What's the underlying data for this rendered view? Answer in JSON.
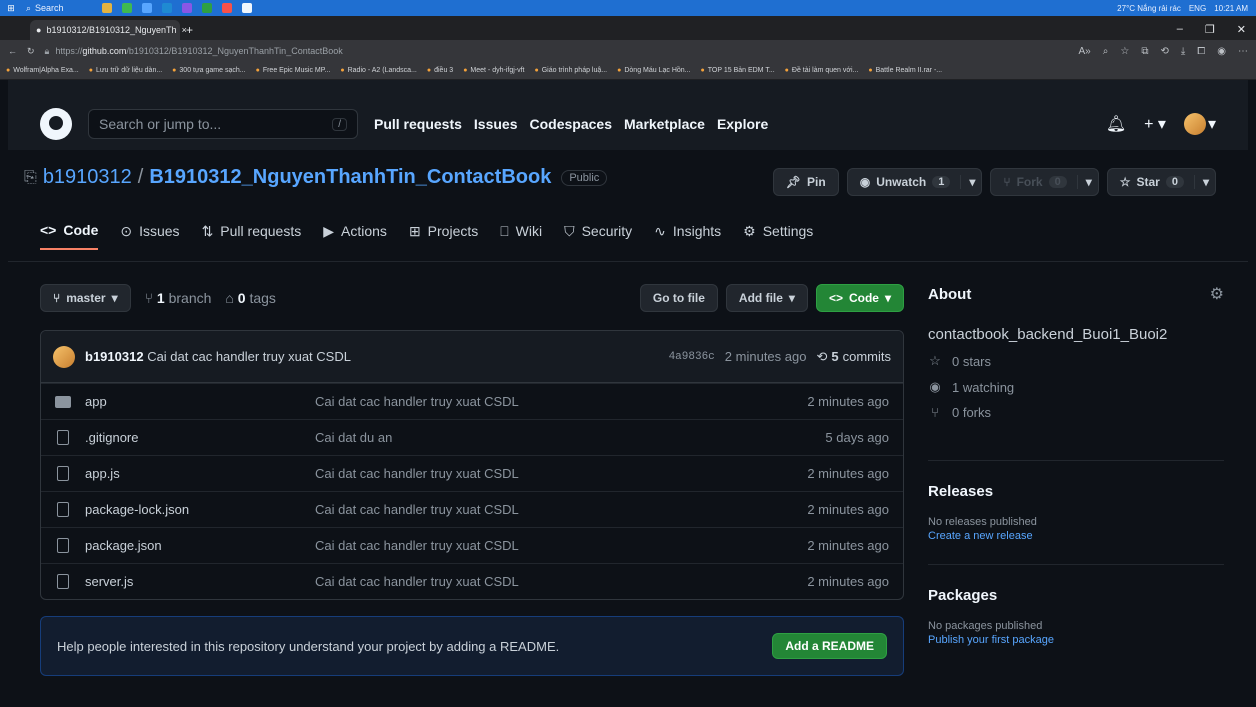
{
  "taskbar": {
    "search_label": "Search",
    "weather": "27°C  Nắng rải rác",
    "lang": "ENG",
    "time": "10:21 AM"
  },
  "browser": {
    "tab_title": "b1910312/B1910312_NguyenTh",
    "url_prefix": "https://",
    "url_domain": "github.com",
    "url_path": "/b1910312/B1910312_NguyenThanhTin_ContactBook",
    "bookmarks": [
      "Wolfram|Alpha Exa...",
      "Lưu trữ dữ liệu dàn...",
      "300 tựa game sạch...",
      "Free Epic Music MP...",
      "Radio - A2 (Landsca...",
      "điều 3",
      "Meet - dyh-ifgj-vft",
      "Giáo trình pháp luậ...",
      "Dòng Máu Lạc Hồn...",
      "TOP 15 Bản EDM T...",
      "Đề tài làm quen với...",
      "Battle Realm II.rar -..."
    ]
  },
  "header": {
    "search_placeholder": "Search or jump to...",
    "slash": "/",
    "nav": [
      "Pull requests",
      "Issues",
      "Codespaces",
      "Marketplace",
      "Explore"
    ]
  },
  "repo": {
    "owner": "b1910312",
    "separator": "/",
    "name": "B1910312_NguyenThanhTin_ContactBook",
    "visibility": "Public",
    "pin_label": "Pin",
    "unwatch_label": "Unwatch",
    "watch_count": "1",
    "fork_label": "Fork",
    "fork_count": "0",
    "star_label": "Star",
    "star_count": "0"
  },
  "repo_nav": [
    {
      "label": "Code",
      "icon": "<>"
    },
    {
      "label": "Issues",
      "icon": "⊙"
    },
    {
      "label": "Pull requests",
      "icon": "⇅"
    },
    {
      "label": "Actions",
      "icon": "▶"
    },
    {
      "label": "Projects",
      "icon": "⊞"
    },
    {
      "label": "Wiki",
      "icon": "⎕"
    },
    {
      "label": "Security",
      "icon": "⛉"
    },
    {
      "label": "Insights",
      "icon": "∿"
    },
    {
      "label": "Settings",
      "icon": "⚙"
    }
  ],
  "toolbar": {
    "branch": "master",
    "branch_count": "1",
    "branch_label": "branch",
    "tag_count": "0",
    "tag_label": "tags",
    "go_to_file": "Go to file",
    "add_file": "Add file",
    "code": "Code"
  },
  "commit": {
    "author": "b1910312",
    "message": "Cai dat cac handler truy xuat CSDL",
    "sha": "4a9836c",
    "time": "2 minutes ago",
    "count": "5",
    "count_label": "commits"
  },
  "files": [
    {
      "name": "app",
      "type": "folder",
      "message": "Cai dat cac handler truy xuat CSDL",
      "time": "2 minutes ago"
    },
    {
      "name": ".gitignore",
      "type": "file",
      "message": "Cai dat du an",
      "time": "5 days ago"
    },
    {
      "name": "app.js",
      "type": "file",
      "message": "Cai dat cac handler truy xuat CSDL",
      "time": "2 minutes ago"
    },
    {
      "name": "package-lock.json",
      "type": "file",
      "message": "Cai dat cac handler truy xuat CSDL",
      "time": "2 minutes ago"
    },
    {
      "name": "package.json",
      "type": "file",
      "message": "Cai dat cac handler truy xuat CSDL",
      "time": "2 minutes ago"
    },
    {
      "name": "server.js",
      "type": "file",
      "message": "Cai dat cac handler truy xuat CSDL",
      "time": "2 minutes ago"
    }
  ],
  "readme": {
    "text": "Help people interested in this repository understand your project by adding a README.",
    "button": "Add a README"
  },
  "sidebar": {
    "about_title": "About",
    "description": "contactbook_backend_Buoi1_Buoi2",
    "stars": "0 stars",
    "watching": "1 watching",
    "forks": "0 forks",
    "releases_title": "Releases",
    "no_releases": "No releases published",
    "create_release": "Create a new release",
    "packages_title": "Packages",
    "no_packages": "No packages published",
    "publish_package": "Publish your first package"
  }
}
